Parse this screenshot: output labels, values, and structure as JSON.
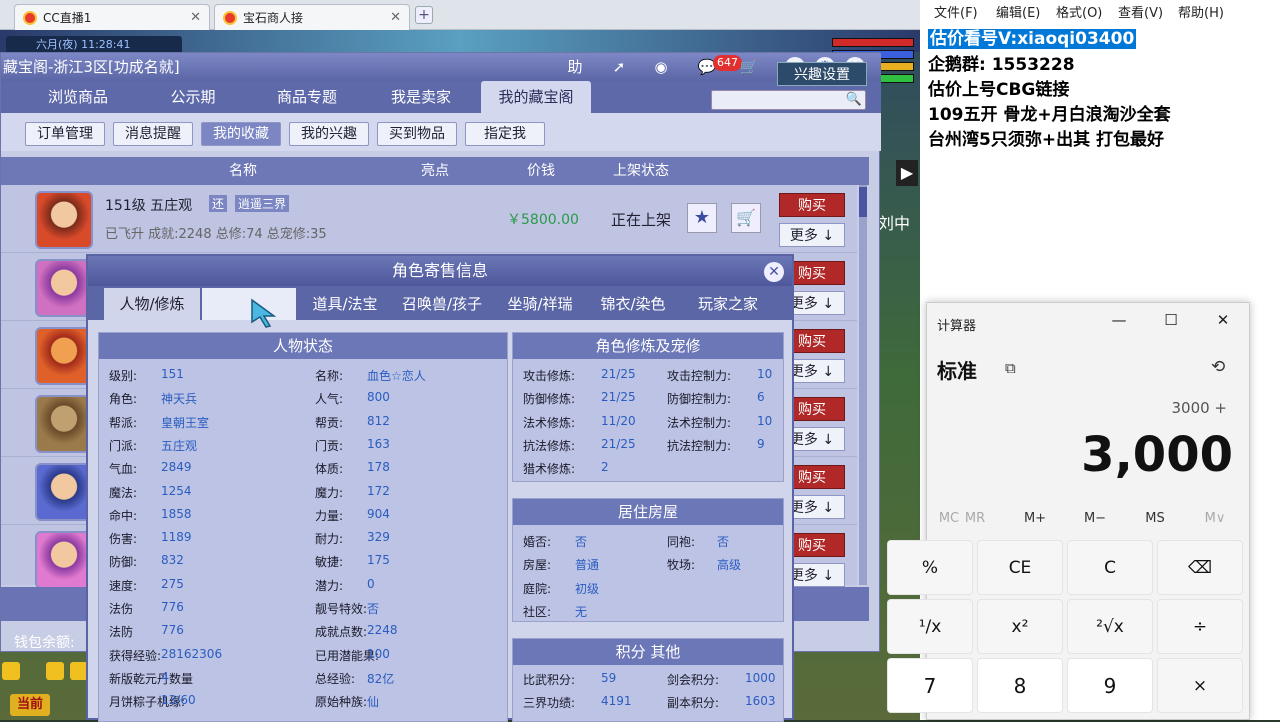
{
  "browser": {
    "tabs": [
      {
        "label": "CC直播1",
        "close": "✕"
      },
      {
        "label": "宝石商人接",
        "close": "✕"
      }
    ],
    "new_tab": "+"
  },
  "scene": {
    "hud_date": "六月(夜)  11:28:41",
    "right_text": "刘中"
  },
  "window": {
    "title": "藏宝阁-浙江3区[功成名就]",
    "title_buttons": [
      "助"
    ],
    "badge": "647",
    "nav_tabs": [
      "浏览商品",
      "公示期",
      "商品专题",
      "我是卖家",
      "我的藏宝阁"
    ],
    "active_nav": 4,
    "sub_buttons": [
      "订单管理",
      "消息提醒",
      "我的收藏",
      "我的兴趣",
      "买到物品",
      "指定我"
    ],
    "active_sub": 2,
    "interest_button": "兴趣设置",
    "columns": [
      "名称",
      "亮点",
      "价钱",
      "上架状态"
    ],
    "first_item": {
      "level_name": "151级  五庄观",
      "tag1": "还",
      "tag2": "逍遥三界",
      "details": "已飞升  成就:2248  总修:74  总宠修:35",
      "price": "￥5800.00",
      "status": "正在上架"
    },
    "buy_label": "购买",
    "more_label": "更多 ↓",
    "wallet": "钱包余额:",
    "bottom_label": "当前"
  },
  "popup": {
    "title": "角色寄售信息",
    "close": "✕",
    "tabs": [
      "人物/修炼",
      "",
      "道具/法宝",
      "召唤兽/孩子",
      "坐骑/祥瑞",
      "锦衣/染色",
      "玩家之家"
    ],
    "active_tab": 0,
    "status_panel": {
      "title": "人物状态",
      "left": [
        {
          "k": "级别:",
          "v": "151"
        },
        {
          "k": "角色:",
          "v": "神天兵"
        },
        {
          "k": "帮派:",
          "v": "皇朝王室"
        },
        {
          "k": "门派:",
          "v": "五庄观"
        },
        {
          "k": "气血:",
          "v": "2849"
        },
        {
          "k": "魔法:",
          "v": "1254"
        },
        {
          "k": "命中:",
          "v": "1858"
        },
        {
          "k": "伤害:",
          "v": "1189"
        },
        {
          "k": "防御:",
          "v": "832"
        },
        {
          "k": "速度:",
          "v": "275"
        },
        {
          "k": "法伤",
          "v": "776"
        },
        {
          "k": "法防",
          "v": "776"
        },
        {
          "k": "获得经验:",
          "v": "28162306"
        },
        {
          "k": "新版乾元丹数量",
          "v": "4"
        },
        {
          "k": "月饼粽子机缘:",
          "v": "13/60"
        }
      ],
      "right": [
        {
          "k": "名称:",
          "v": "血色☆恋人"
        },
        {
          "k": "人气:",
          "v": "800"
        },
        {
          "k": "帮贡:",
          "v": "812"
        },
        {
          "k": "门贡:",
          "v": "163"
        },
        {
          "k": "体质:",
          "v": "178"
        },
        {
          "k": "魔力:",
          "v": "172"
        },
        {
          "k": "力量:",
          "v": "904"
        },
        {
          "k": "耐力:",
          "v": "329"
        },
        {
          "k": "敏捷:",
          "v": "175"
        },
        {
          "k": "潜力:",
          "v": "0"
        },
        {
          "k": "靓号特效:",
          "v": "否"
        },
        {
          "k": "成就点数:",
          "v": "2248"
        },
        {
          "k": "已用潜能果:",
          "v": "100"
        },
        {
          "k": "总经验:",
          "v": "82亿"
        },
        {
          "k": "原始种族:",
          "v": "仙"
        }
      ]
    },
    "cultivation_panel": {
      "title": "角色修炼及宠修",
      "left": [
        {
          "k": "攻击修炼:",
          "v": "21/25"
        },
        {
          "k": "防御修炼:",
          "v": "21/25"
        },
        {
          "k": "法术修炼:",
          "v": "11/20"
        },
        {
          "k": "抗法修炼:",
          "v": "21/25"
        },
        {
          "k": "猎术修炼:",
          "v": "2"
        }
      ],
      "right": [
        {
          "k": "攻击控制力:",
          "v": "10"
        },
        {
          "k": "防御控制力:",
          "v": "6"
        },
        {
          "k": "法术控制力:",
          "v": "10"
        },
        {
          "k": "抗法控制力:",
          "v": "9"
        }
      ]
    },
    "house_panel": {
      "title": "居住房屋",
      "left": [
        {
          "k": "婚否:",
          "v": "否"
        },
        {
          "k": "房屋:",
          "v": "普通"
        },
        {
          "k": "庭院:",
          "v": "初级"
        },
        {
          "k": "社区:",
          "v": "无"
        }
      ],
      "right": [
        {
          "k": "同袍:",
          "v": "否"
        },
        {
          "k": "牧场:",
          "v": "高级"
        }
      ]
    },
    "score_panel": {
      "title": "积分 其他",
      "left": [
        {
          "k": "比武积分:",
          "v": "59"
        },
        {
          "k": "三界功绩:",
          "v": "4191"
        }
      ],
      "right": [
        {
          "k": "剑会积分:",
          "v": "1000"
        },
        {
          "k": "副本积分:",
          "v": "1603"
        }
      ]
    }
  },
  "notepad": {
    "menu": [
      "文件(F)",
      "编辑(E)",
      "格式(O)",
      "查看(V)",
      "帮助(H)"
    ],
    "lines": [
      "估价看号V:xiaoqi03400",
      "企鹅群:  1553228",
      "估价上号CBG链接",
      "109五开 骨龙+月白浪淘沙全套",
      "台州湾5只须弥+出其 打包最好"
    ]
  },
  "calculator": {
    "title": "计算器",
    "mode": "标准",
    "expression": "3000 +",
    "display": "3,000",
    "memory": [
      "MC",
      "MR",
      "M+",
      "M−",
      "MS",
      "M∨"
    ],
    "keys_row1": [
      "%",
      "CE",
      "C",
      "⌫"
    ],
    "keys_row2": [
      "¹/x",
      "x²",
      "²√x",
      "÷"
    ],
    "keys_row3": [
      "7",
      "8",
      "9",
      "×"
    ]
  }
}
